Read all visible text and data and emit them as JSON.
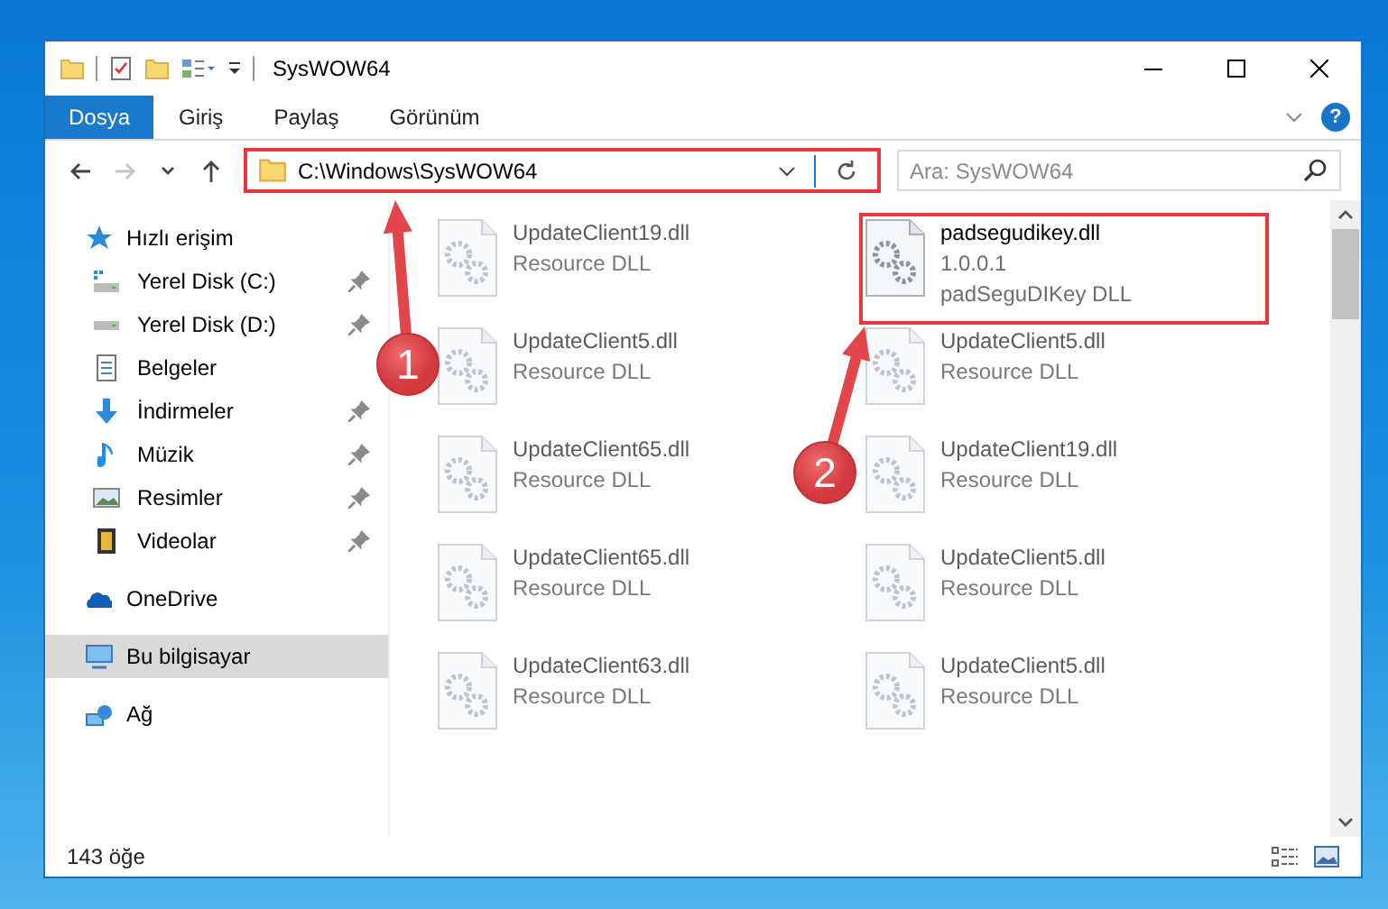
{
  "window": {
    "title": "SysWOW64"
  },
  "ribbon": {
    "tabs": [
      {
        "label": "Dosya",
        "selected": true
      },
      {
        "label": "Giriş",
        "selected": false
      },
      {
        "label": "Paylaş",
        "selected": false
      },
      {
        "label": "Görünüm",
        "selected": false
      }
    ],
    "help": "?"
  },
  "navigation": [
    {
      "kind": "back",
      "disabled": false
    },
    {
      "kind": "forward",
      "disabled": true
    },
    {
      "kind": "recent",
      "disabled": false
    },
    {
      "kind": "up",
      "disabled": false
    }
  ],
  "address": {
    "value": "C:\\Windows\\SysWOW64",
    "highlighted": true
  },
  "search": {
    "placeholder": "Ara: SysWOW64"
  },
  "sidebar": {
    "items": [
      {
        "label": "Hızlı erişim",
        "kind": "quick",
        "selected": false,
        "children": [
          {
            "label": "Yerel Disk (C:)",
            "kind": "system-drive",
            "pinned": true
          },
          {
            "label": "Yerel Disk (D:)",
            "kind": "drive",
            "pinned": true
          },
          {
            "label": "Belgeler",
            "kind": "documents",
            "pinned": false
          },
          {
            "label": "İndirmeler",
            "kind": "downloads",
            "pinned": true
          },
          {
            "label": "Müzik",
            "kind": "music",
            "pinned": true
          },
          {
            "label": "Resimler",
            "kind": "pictures",
            "pinned": true
          },
          {
            "label": "Videolar",
            "kind": "videos",
            "pinned": true
          }
        ]
      },
      {
        "label": "OneDrive",
        "kind": "cloud",
        "selected": false
      },
      {
        "label": "Bu bilgisayar",
        "kind": "computer",
        "selected": true
      },
      {
        "label": "Ağ",
        "kind": "network",
        "selected": false
      }
    ]
  },
  "files": [
    {
      "name": "UpdateClient19.dll",
      "details": [
        "Resource DLL"
      ],
      "blurred": true,
      "highlighted": false
    },
    {
      "name": "padsegudikey.dll",
      "details": [
        "1.0.0.1",
        "padSeguDIKey DLL"
      ],
      "blurred": false,
      "highlighted": true
    },
    {
      "name": "UpdateClient5.dll",
      "details": [
        "Resource DLL"
      ],
      "blurred": true,
      "highlighted": false
    },
    {
      "name": "UpdateClient5.dll",
      "details": [
        "Resource DLL"
      ],
      "blurred": true,
      "highlighted": false
    },
    {
      "name": "UpdateClient65.dll",
      "details": [
        "Resource DLL"
      ],
      "blurred": true,
      "highlighted": false
    },
    {
      "name": "UpdateClient19.dll",
      "details": [
        "Resource DLL"
      ],
      "blurred": true,
      "highlighted": false
    },
    {
      "name": "UpdateClient65.dll",
      "details": [
        "Resource DLL"
      ],
      "blurred": true,
      "highlighted": false
    },
    {
      "name": "UpdateClient5.dll",
      "details": [
        "Resource DLL"
      ],
      "blurred": true,
      "highlighted": false
    },
    {
      "name": "UpdateClient63.dll",
      "details": [
        "Resource DLL"
      ],
      "blurred": true,
      "highlighted": false
    },
    {
      "name": "UpdateClient5.dll",
      "details": [
        "Resource DLL"
      ],
      "blurred": true,
      "highlighted": false
    }
  ],
  "status_bar": {
    "item_count": "143 öğe"
  },
  "annotations": [
    {
      "label": "1"
    },
    {
      "label": "2"
    }
  ]
}
